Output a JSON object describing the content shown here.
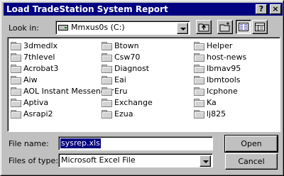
{
  "window": {
    "title": "Load TradeStation System Report",
    "help_label": "?",
    "close_label": "×"
  },
  "lookin": {
    "label": "Look in:",
    "value": "Mmxus0s (C:)"
  },
  "files": [
    {
      "name": "3dmedlx"
    },
    {
      "name": "7thlevel"
    },
    {
      "name": "Acrobat3"
    },
    {
      "name": "Aiw"
    },
    {
      "name": "AOL Instant Messenger"
    },
    {
      "name": "Aptiva"
    },
    {
      "name": "Asrapi2"
    },
    {
      "name": "Btown"
    },
    {
      "name": "Csw70"
    },
    {
      "name": "Diagnost"
    },
    {
      "name": "Eai"
    },
    {
      "name": "Eru"
    },
    {
      "name": "Exchange"
    },
    {
      "name": "Ezua"
    },
    {
      "name": "Helper"
    },
    {
      "name": "host-news"
    },
    {
      "name": "Ibmav95"
    },
    {
      "name": "Ibmtools"
    },
    {
      "name": "Icphone"
    },
    {
      "name": "Ka"
    },
    {
      "name": "lj825"
    }
  ],
  "filename": {
    "label": "File name:",
    "value": "sysrep.xls"
  },
  "filetype": {
    "label": "Files of type:",
    "value": "Microsoft Excel File"
  },
  "buttons": {
    "open": "Open",
    "cancel": "Cancel"
  }
}
